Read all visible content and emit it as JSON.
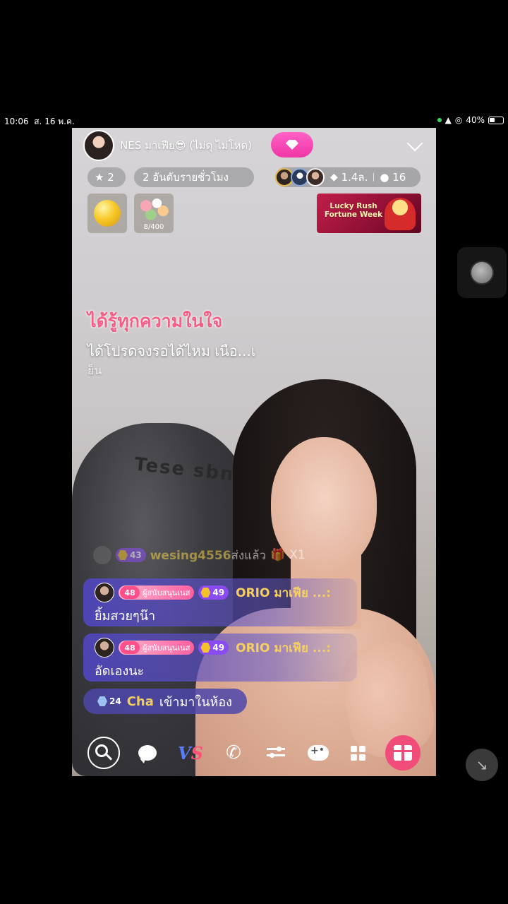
{
  "status_bar": {
    "time": "10:06",
    "date": "ส. 16 พ.ค.",
    "battery": "40%"
  },
  "host": {
    "name": "NES มาเฟีย😎 (ไม่ดุ ไม่โหด)"
  },
  "stats": {
    "stars": "2",
    "rank": "2 อันดับรายชั่วโมง",
    "diamonds": "1.4ล.",
    "viewers": "16"
  },
  "badges": {
    "flower_count": "8/400"
  },
  "promo": {
    "text": "Lucky Rush Fortune Week"
  },
  "lyrics": {
    "line1": "ได้รู้ทุกความในใจ",
    "line2": "ได้โปรดจงรอได้ไหม เนือ...เ",
    "line3": "ย็น"
  },
  "background": {
    "chair_text": "Tese sbne"
  },
  "gift_notification": {
    "level": "43",
    "user": "wesing4556",
    "action": "ส่งแล้ว",
    "count": "X1"
  },
  "chat": [
    {
      "heart_level": "48",
      "fan_label": "ผู้สนับสนุนเนส",
      "user_level": "49",
      "user": "ORIO มาเฟีย ...:",
      "message": "ยิ้มสวยๆน๊า"
    },
    {
      "heart_level": "48",
      "fan_label": "ผู้สนับสนุนเนส",
      "user_level": "49",
      "user": "ORIO มาเฟีย ...:",
      "message": "อัดเองนะ"
    }
  ],
  "join_notice": {
    "level": "24",
    "user": "Cha",
    "action": "เข้ามาในห้อง"
  },
  "colors": {
    "follow_pink": "#f035a6",
    "lyric_pink": "#f55f87",
    "chat_blue": "#5246c8",
    "username_gold": "#f6cf62",
    "gift_red": "#f24c7a"
  }
}
